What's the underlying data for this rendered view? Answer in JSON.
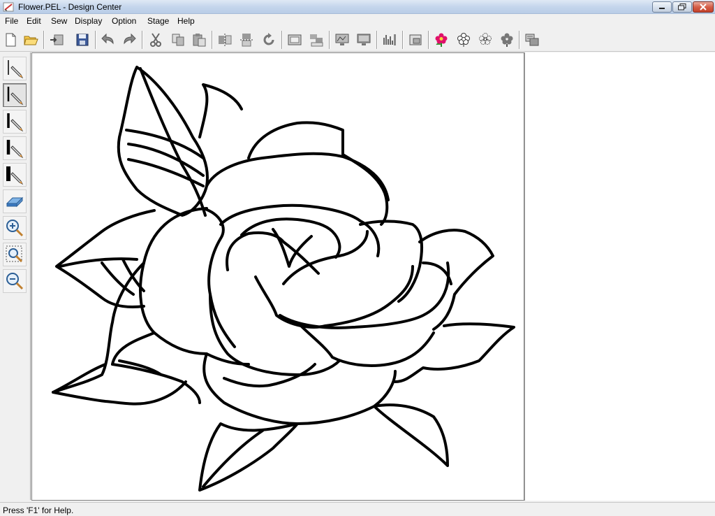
{
  "window": {
    "title": "Flower.PEL - Design Center",
    "controls": {
      "minimize": "minimize",
      "maximize": "restore",
      "close": "close"
    }
  },
  "menu": [
    "File",
    "Edit",
    "Sew",
    "Display",
    "Option",
    "Stage",
    "Help"
  ],
  "toolbar": {
    "icons": [
      "new-file-icon",
      "open-folder-icon",
      "import-icon",
      "save-icon",
      "undo-icon",
      "redo-icon",
      "cut-icon",
      "copy-icon",
      "paste-icon",
      "mirror-horizontal-icon",
      "mirror-vertical-icon",
      "rotate-icon",
      "frame-icon",
      "counter-icon",
      "monitor-icon",
      "preview-icon",
      "stitch-bars-icon",
      "window-icon",
      "flower-icon",
      "outline-flower-icon",
      "dotted-flower-icon",
      "filled-flower-icon",
      "transfer-icon"
    ]
  },
  "left_tools": [
    {
      "name": "pen-thin-tool",
      "active": false
    },
    {
      "name": "pen-medium-tool",
      "active": true
    },
    {
      "name": "pen-thick-tool",
      "active": false
    },
    {
      "name": "pen-thicker-tool",
      "active": false
    },
    {
      "name": "pen-thickest-tool",
      "active": false
    },
    {
      "name": "eraser-tool",
      "active": false
    },
    {
      "name": "zoom-in-tool",
      "active": false
    },
    {
      "name": "zoom-fit-tool",
      "active": false
    },
    {
      "name": "zoom-out-tool",
      "active": false
    }
  ],
  "statusbar": {
    "text": "Press 'F1' for Help."
  },
  "colors": {
    "accent_flower": "#e0106a",
    "titlebar": "#c5d6ec"
  }
}
